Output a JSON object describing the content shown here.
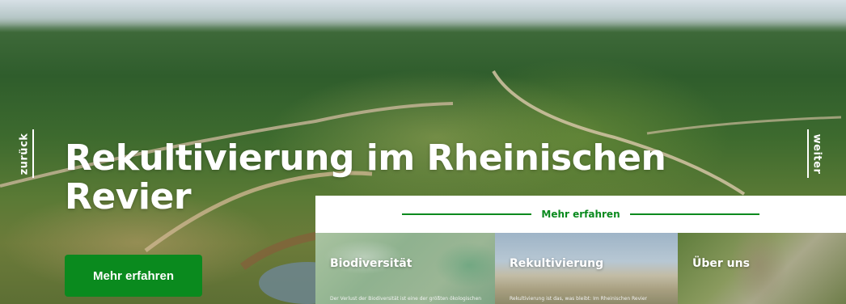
{
  "hero": {
    "title": "Rekultivierung im Rheinischen Revier",
    "prev_label": "zurück",
    "next_label": "weiter",
    "cta_label": "Mehr erfahren"
  },
  "panel": {
    "heading": "Mehr erfahren",
    "cards": [
      {
        "title": "Biodiversität",
        "text": "Der Verlust der Biodiversität ist eine der größten ökologischen"
      },
      {
        "title": "Rekultivierung",
        "text": "Rekultivierung ist das, was bleibt: Im Rheinischen Revier"
      },
      {
        "title": "Über uns",
        "text": ""
      }
    ]
  },
  "colors": {
    "accent": "#0a8a1e",
    "text_on_image": "#ffffff"
  }
}
